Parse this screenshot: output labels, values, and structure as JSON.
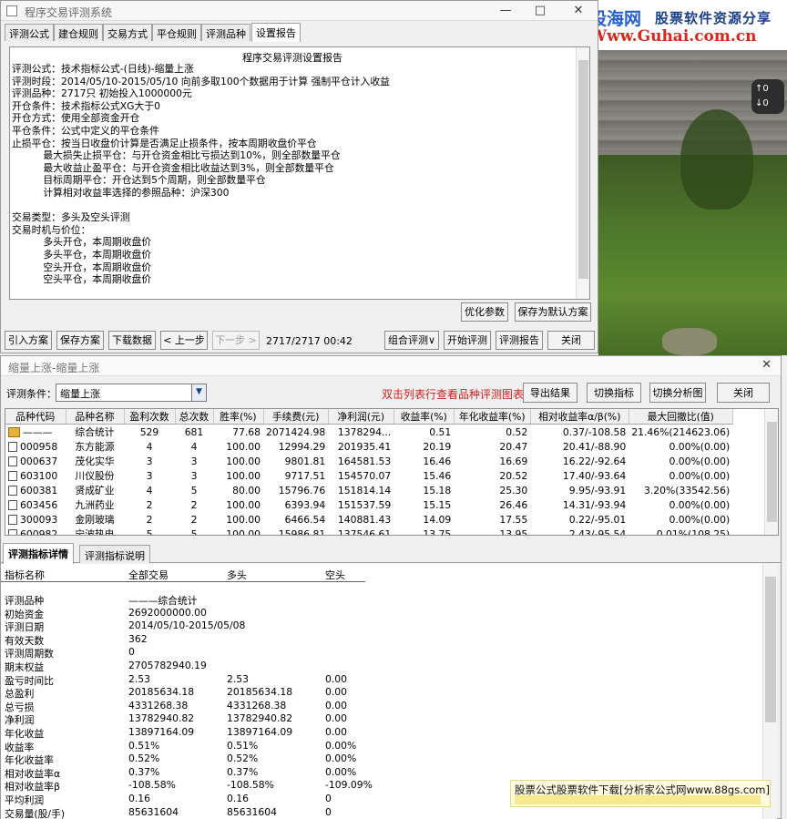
{
  "top_window": {
    "title": "程序交易评测系统",
    "controls": {
      "minimize": "—",
      "maximize": "□",
      "close": "✕"
    },
    "tabs": [
      "评测公式",
      "建仓规则",
      "交易方式",
      "平仓规则",
      "评测品种",
      "设置报告"
    ],
    "report_title": "程序交易评测设置报告",
    "report_lines": [
      "评测公式：技术指标公式-(日线)-缩量上涨",
      "评测时段：2014/05/10-2015/05/10 向前多取100个数据用于计算 强制平仓计入收益",
      "评测品种：2717只 初始投入1000000元",
      "开仓条件：技术指标公式XG大于0",
      "开仓方式：使用全部资金开仓",
      "平仓条件：公式中定义的平仓条件",
      "止损平仓：按当日收盘价计算是否满足止损条件，按本周期收盘价平仓",
      "          最大损失止损平仓：与开仓资金相比亏损达到10%，则全部数量平仓",
      "          最大收益止盈平仓：与开仓资金相比收益达到3%，则全部数量平仓",
      "          目标周期平仓：开仓达到5个周期，则全部数量平仓",
      "          计算相对收益率选择的参照品种：沪深300",
      "",
      "交易类型：多头及空头评测",
      "交易时机与价位：",
      "          多头开仓，本周期收盘价",
      "          多头平仓，本周期收盘价",
      "          空头开仓，本周期收盘价",
      "          空头平仓，本周期收盘价"
    ],
    "buttons": {
      "optimize": "优化参数",
      "save_default": "保存为默认方案",
      "import": "引入方案",
      "save": "保存方案",
      "download": "下载数据",
      "prev": "< 上一步",
      "next": "下一步 >",
      "combo": "组合评测∨",
      "start": "开始评测",
      "report": "评测报告",
      "close": "关闭"
    },
    "progress_text": "2717/2717 00:42"
  },
  "photo": {
    "brand_cn": "股海网",
    "brand_tag": "股票软件资源分享",
    "brand_url": "Www.Guhai.com.cn",
    "overlay": [
      "↑0",
      "↓0"
    ]
  },
  "bottom_window": {
    "title": "缩量上涨-缩量上涨",
    "close": "✕",
    "condition_label": "评测条件：",
    "condition_value": "缩量上涨",
    "hint": "双击列表行查看品种评测图表",
    "buttons": {
      "export": "导出结果",
      "switch_indicator": "切换指标",
      "switch_chart": "切换分析图",
      "close": "关闭"
    },
    "table": {
      "columns": [
        "品种代码",
        "品种名称",
        "盈利次数",
        "总次数",
        "胜率(%)",
        "手续费(元)",
        "净利润(元)",
        "收益率(%)",
        "年化收益率(%)",
        "相对收益率α/β(%)",
        "最大回撤比(值)"
      ],
      "rows": [
        {
          "code": "———",
          "name": "综合统计",
          "wins": "529",
          "total": "681",
          "winrate": "77.68",
          "fee": "2071424.98",
          "profit": "1378294...",
          "ret": "0.51",
          "annual": "0.52",
          "rel": "0.37/-108.58",
          "dd": "21.46%(214623.06)",
          "summary": true
        },
        {
          "code": "000958",
          "name": "东方能源",
          "wins": "4",
          "total": "4",
          "winrate": "100.00",
          "fee": "12994.29",
          "profit": "201935.41",
          "ret": "20.19",
          "annual": "20.47",
          "rel": "20.41/-88.90",
          "dd": "0.00%(0.00)"
        },
        {
          "code": "000637",
          "name": "茂化实华",
          "wins": "3",
          "total": "3",
          "winrate": "100.00",
          "fee": "9801.81",
          "profit": "164581.53",
          "ret": "16.46",
          "annual": "16.69",
          "rel": "16.22/-92.64",
          "dd": "0.00%(0.00)"
        },
        {
          "code": "603100",
          "name": "川仪股份",
          "wins": "3",
          "total": "3",
          "winrate": "100.00",
          "fee": "9717.51",
          "profit": "154570.07",
          "ret": "15.46",
          "annual": "20.52",
          "rel": "17.40/-93.64",
          "dd": "0.00%(0.00)"
        },
        {
          "code": "600381",
          "name": "贤成矿业",
          "wins": "4",
          "total": "5",
          "winrate": "80.00",
          "fee": "15796.76",
          "profit": "151814.14",
          "ret": "15.18",
          "annual": "25.30",
          "rel": "9.95/-93.91",
          "dd": "3.20%(33542.56)"
        },
        {
          "code": "603456",
          "name": "九洲药业",
          "wins": "2",
          "total": "2",
          "winrate": "100.00",
          "fee": "6393.94",
          "profit": "151537.59",
          "ret": "15.15",
          "annual": "26.46",
          "rel": "14.31/-93.94",
          "dd": "0.00%(0.00)"
        },
        {
          "code": "300093",
          "name": "金刚玻璃",
          "wins": "2",
          "total": "2",
          "winrate": "100.00",
          "fee": "6466.54",
          "profit": "140881.43",
          "ret": "14.09",
          "annual": "17.55",
          "rel": "0.22/-95.01",
          "dd": "0.00%(0.00)"
        },
        {
          "code": "600982",
          "name": "宁波热电",
          "wins": "5",
          "total": "5",
          "winrate": "100.00",
          "fee": "15986.81",
          "profit": "137546.61",
          "ret": "13.75",
          "annual": "13.95",
          "rel": "2.43/-95.54",
          "dd": "0.01%(108.25)"
        }
      ]
    },
    "detail_tabs": [
      "评测指标详情",
      "评测指标说明"
    ],
    "detail_headers": [
      "指标名称",
      "全部交易",
      "多头",
      "空头"
    ],
    "detail_rows": [
      {
        "name": "评测品种",
        "all": "———综合统计",
        "long": "",
        "short": ""
      },
      {
        "name": "初始资金",
        "all": "2692000000.00",
        "long": "",
        "short": ""
      },
      {
        "name": "评测日期",
        "all": "2014/05/10-2015/05/08",
        "long": "",
        "short": ""
      },
      {
        "name": "有效天数",
        "all": "362",
        "long": "",
        "short": ""
      },
      {
        "name": "评测周期数",
        "all": "0",
        "long": "",
        "short": ""
      },
      {
        "name": "期末权益",
        "all": "2705782940.19",
        "long": "",
        "short": ""
      },
      {
        "name": "盈亏时间比",
        "all": "2.53",
        "long": "2.53",
        "short": "0.00"
      },
      {
        "name": "总盈利",
        "all": "20185634.18",
        "long": "20185634.18",
        "short": "0.00"
      },
      {
        "name": "总亏损",
        "all": "4331268.38",
        "long": "4331268.38",
        "short": "0.00"
      },
      {
        "name": "净利润",
        "all": "13782940.82",
        "long": "13782940.82",
        "short": "0.00"
      },
      {
        "name": "年化收益",
        "all": "13897164.09",
        "long": "13897164.09",
        "short": "0.00"
      },
      {
        "name": "收益率",
        "all": "0.51%",
        "long": "0.51%",
        "short": "0.00%"
      },
      {
        "name": "年化收益率",
        "all": "0.52%",
        "long": "0.52%",
        "short": "0.00%"
      },
      {
        "name": "相对收益率α",
        "all": "0.37%",
        "long": "0.37%",
        "short": "0.00%"
      },
      {
        "name": "相对收益率β",
        "all": "-108.58%",
        "long": "-108.58%",
        "short": "-109.09%"
      },
      {
        "name": "平均利润",
        "all": "0.16",
        "long": "0.16",
        "short": "0"
      },
      {
        "name": "交易量(股/手)",
        "all": "85631604",
        "long": "85631604",
        "short": "0"
      }
    ]
  },
  "watermark": "股票公式股票软件下载[分析家公式网www.88gs.com]"
}
